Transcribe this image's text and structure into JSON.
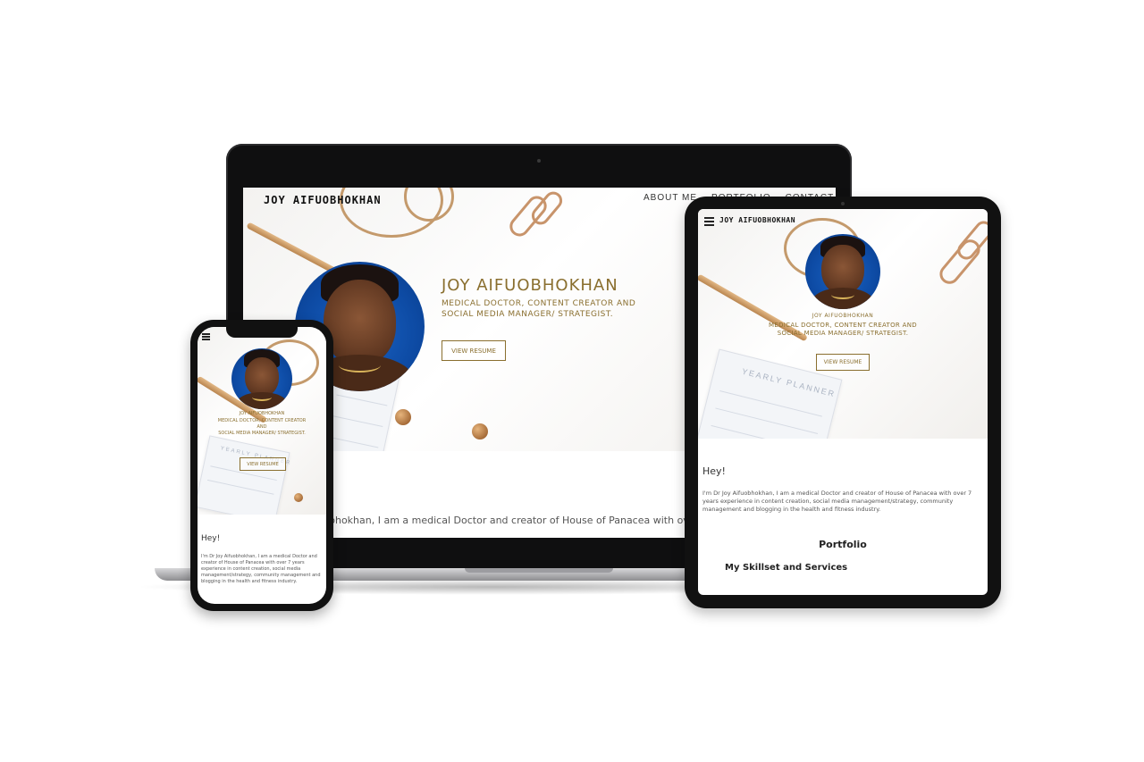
{
  "site": {
    "logo": "JOY AIFUOBHOKHAN",
    "name": "JOY AIFUOBHOKHAN",
    "tagline_line1": "MEDICAL DOCTOR, CONTENT CREATOR AND",
    "tagline_line2": "SOCIAL MEDIA MANAGER/ STRATEGIST.",
    "resume_button": "VIEW RESUME"
  },
  "laptop": {
    "nav": [
      "ABOUT ME",
      "PORTFOLIO",
      "CONTACT"
    ],
    "intro_snippet": "bhokhan, I am a medical Doctor and creator of House of Panacea with over 7"
  },
  "tablet": {
    "name_small": "JOY AIFUOBHOKHAN",
    "tagline_line1": "MEDICAL DOCTOR, CONTENT CREATOR AND",
    "tagline_line2": "SOCIAL MEDIA MANAGER/ STRATEGIST.",
    "planner_title": "YEARLY PLANNER",
    "greeting": "Hey!",
    "intro": "I'm Dr Joy Aifuobhokhan, I am a medical Doctor and creator of House of Panacea with over 7 years experience in content creation, social media management/strategy, community management and blogging in the health and fitness industry.",
    "portfolio_heading": "Portfolio",
    "skills_heading": "My Skillset and Services"
  },
  "phone": {
    "name_small": "JOY AIFUOBHOKHAN",
    "tagline_line1": "MEDICAL DOCTOR, CONTENT CREATOR AND",
    "tagline_line2": "SOCIAL MEDIA MANAGER/ STRATEGIST.",
    "planner_title": "YEARLY PLANNER",
    "greeting": "Hey!",
    "intro": "I'm Dr Joy Aifuobhokhan, I am a medical Doctor and creator of House of Panacea with over 7 years experience in content creation, social media management/strategy, community management and blogging in the health and fitness industry."
  },
  "colors": {
    "accent_gold": "#8a6f2f",
    "device_black": "#111111",
    "portrait_blue": "#0d4aa3"
  }
}
